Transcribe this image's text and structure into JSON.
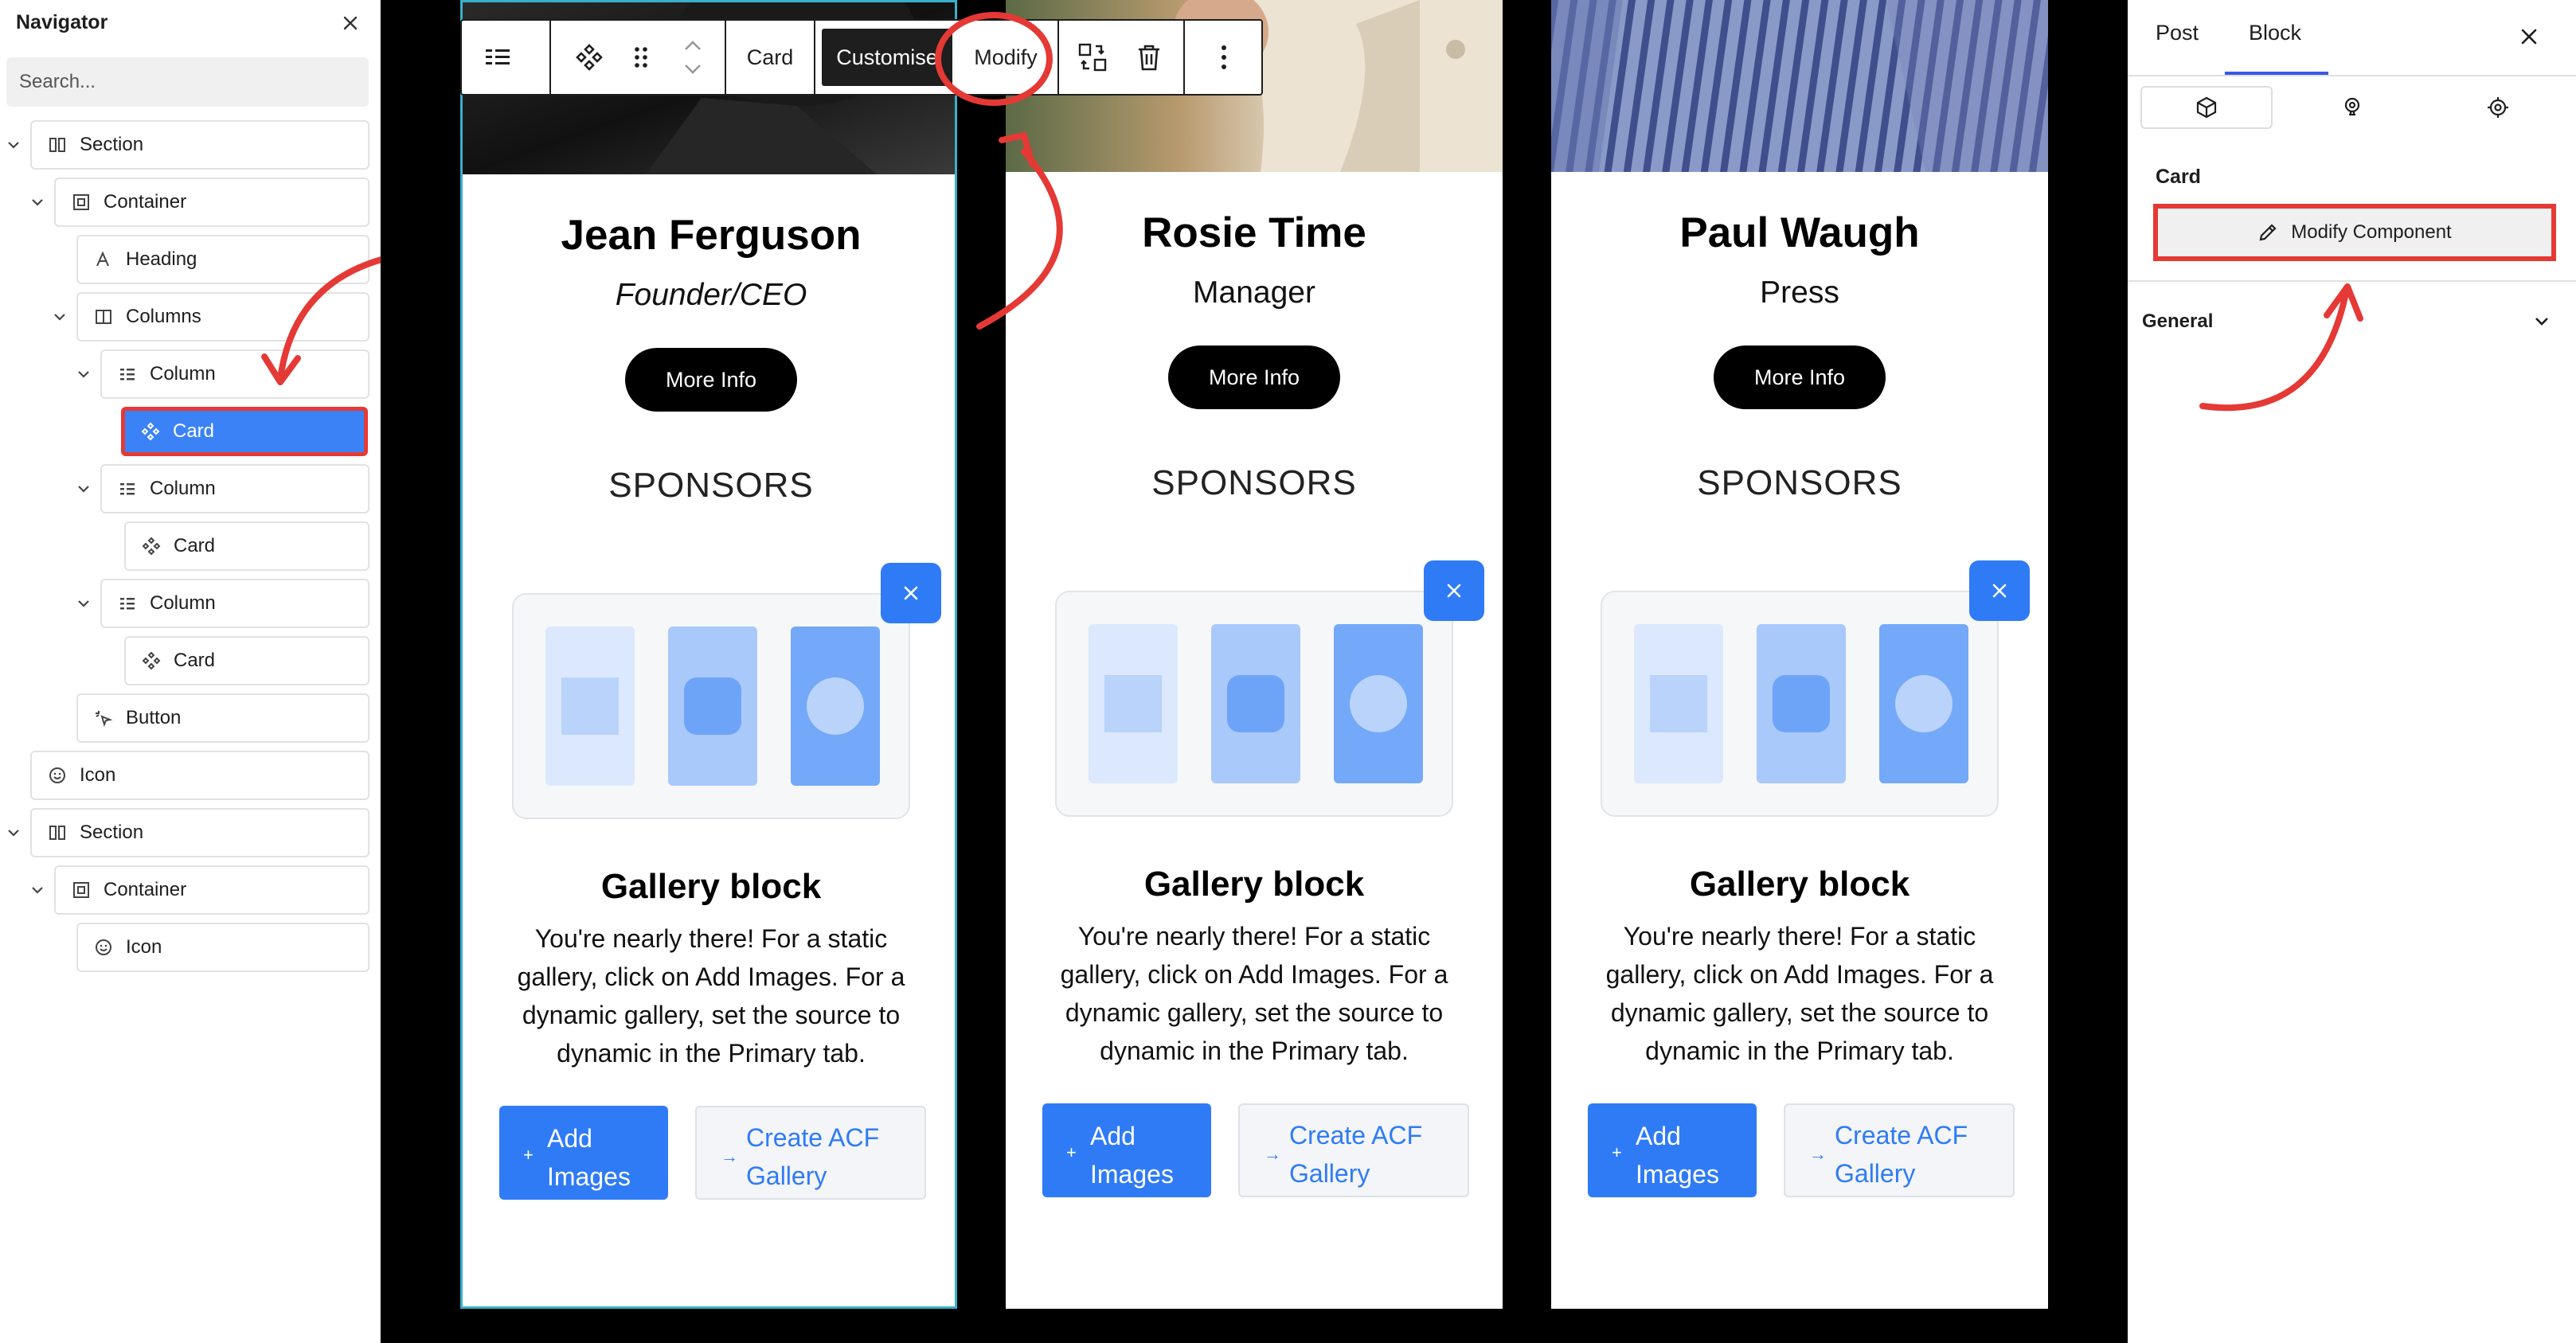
{
  "navigator": {
    "title": "Navigator",
    "search_placeholder": "Search...",
    "tree": [
      {
        "label": "Section",
        "icon": "section-icon"
      },
      {
        "label": "Container",
        "icon": "container-icon"
      },
      {
        "label": "Heading",
        "icon": "heading-icon"
      },
      {
        "label": "Columns",
        "icon": "columns-icon"
      },
      {
        "label": "Column",
        "icon": "column-icon"
      },
      {
        "label": "Card",
        "icon": "component-icon",
        "selected": true
      },
      {
        "label": "Column",
        "icon": "column-icon"
      },
      {
        "label": "Card",
        "icon": "component-icon"
      },
      {
        "label": "Column",
        "icon": "column-icon"
      },
      {
        "label": "Card",
        "icon": "component-icon"
      },
      {
        "label": "Button",
        "icon": "button-icon"
      },
      {
        "label": "Icon",
        "icon": "smiley-icon"
      },
      {
        "label": "Section",
        "icon": "section-icon"
      },
      {
        "label": "Container",
        "icon": "container-icon"
      },
      {
        "label": "Icon",
        "icon": "smiley-icon"
      }
    ]
  },
  "toolbar": {
    "card_label": "Card",
    "customise_label": "Customise",
    "modify_label": "Modify"
  },
  "cards": [
    {
      "name": "Jean Ferguson",
      "role": "Founder/CEO",
      "more_info": "More Info",
      "sponsors": "SPONSORS",
      "gallery_title": "Gallery block",
      "gallery_desc": "You're nearly there! For a static gallery, click on Add Images. For a dynamic gallery, set the source to dynamic in the Primary tab.",
      "add_images": "Add Images",
      "create_acf": "Create ACF Gallery"
    },
    {
      "name": "Rosie Time",
      "role": "Manager",
      "more_info": "More Info",
      "sponsors": "SPONSORS",
      "gallery_title": "Gallery block",
      "gallery_desc": "You're nearly there! For a static gallery, click on Add Images. For a dynamic gallery, set the source to dynamic in the Primary tab.",
      "add_images": "Add Images",
      "create_acf": "Create ACF Gallery"
    },
    {
      "name": "Paul Waugh",
      "role": "Press",
      "more_info": "More Info",
      "sponsors": "SPONSORS",
      "gallery_title": "Gallery block",
      "gallery_desc": "You're nearly there! For a static gallery, click on Add Images. For a dynamic gallery, set the source to dynamic in the Primary tab.",
      "add_images": "Add Images",
      "create_acf": "Create ACF Gallery"
    }
  ],
  "right_panel": {
    "tabs": [
      "Post",
      "Block"
    ],
    "active_tab": "Block",
    "section_label": "Card",
    "modify_component_label": "Modify Component",
    "general_label": "General"
  },
  "colors": {
    "accent_blue": "#2f7bf6",
    "selection_blue": "#3b82f6",
    "annotation_red": "#e53935",
    "wp_blue": "#3858e9"
  }
}
